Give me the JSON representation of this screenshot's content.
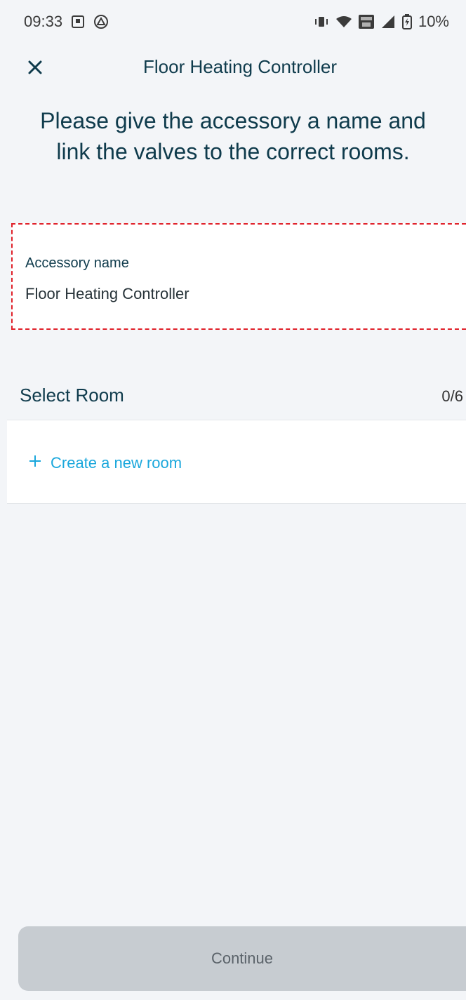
{
  "status_bar": {
    "time": "09:33",
    "battery_percent": "10%"
  },
  "nav": {
    "title": "Floor Heating Controller"
  },
  "instruction": {
    "text": "Please give the accessory a name and link the valves to the correct rooms."
  },
  "accessory": {
    "label": "Accessory name",
    "value": "Floor Heating Controller"
  },
  "rooms": {
    "section_title": "Select Room",
    "counter": "0/6",
    "create_label": "Create a new room"
  },
  "footer": {
    "continue_label": "Continue"
  },
  "colors": {
    "accent": "#1aa7dc",
    "text_primary": "#0f3b4c",
    "highlight_border": "#e0212a",
    "disabled_button": "#c7ccd1"
  }
}
